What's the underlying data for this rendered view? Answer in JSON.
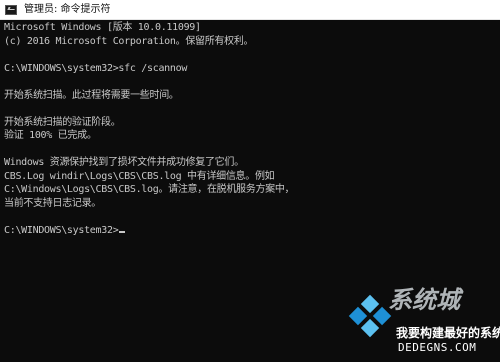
{
  "window": {
    "title": "管理员: 命令提示符"
  },
  "console": {
    "lines": [
      "Microsoft Windows [版本 10.0.11099]",
      "(c) 2016 Microsoft Corporation。保留所有权利。",
      "",
      "C:\\WINDOWS\\system32>sfc /scannow",
      "",
      "开始系统扫描。此过程将需要一些时间。",
      "",
      "开始系统扫描的验证阶段。",
      "验证 100% 已完成。",
      "",
      "Windows 资源保护找到了损坏文件并成功修复了它们。",
      "CBS.Log windir\\Logs\\CBS\\CBS.log 中有详细信息。例如",
      "C:\\Windows\\Logs\\CBS\\CBS.log。请注意，在脱机服务方案中，",
      "当前不支持日志记录。",
      "",
      "C:\\WINDOWS\\system32>"
    ]
  },
  "watermark": {
    "brand": "系统城",
    "slogan": "我要构建最好的系统",
    "domain": "DEDEGNS.COM"
  },
  "colors": {
    "console_bg": "#0c0c0c",
    "console_fg": "#c8c8c8",
    "logo_blue": "#1e90d6",
    "logo_lightblue": "#5cc1f0"
  },
  "icons": {
    "title_icon": "cmd-icon",
    "watermark_logo": "windows-logo-icon"
  }
}
